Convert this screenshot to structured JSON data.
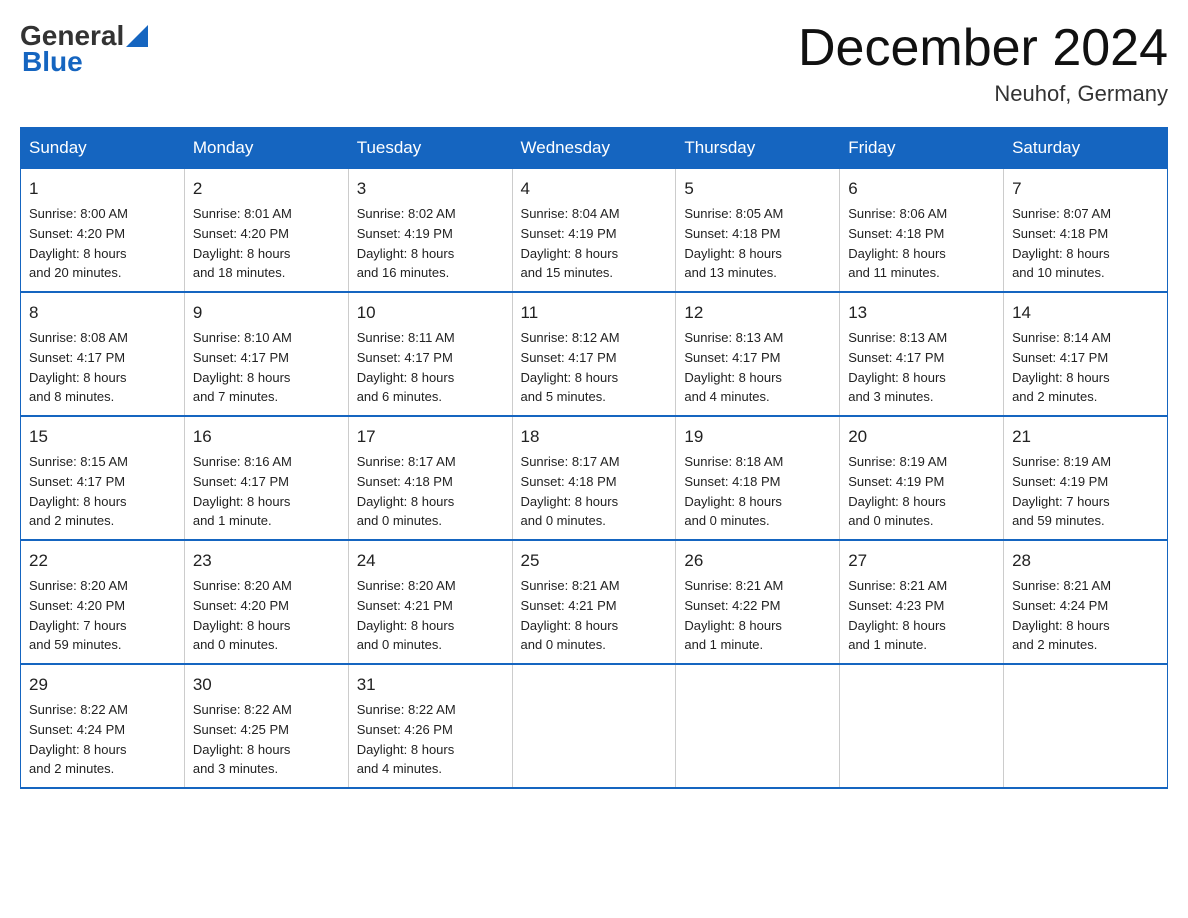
{
  "header": {
    "logo_general": "General",
    "logo_blue": "Blue",
    "month_title": "December 2024",
    "location": "Neuhof, Germany"
  },
  "days_of_week": [
    "Sunday",
    "Monday",
    "Tuesday",
    "Wednesday",
    "Thursday",
    "Friday",
    "Saturday"
  ],
  "weeks": [
    [
      {
        "day": "1",
        "info": "Sunrise: 8:00 AM\nSunset: 4:20 PM\nDaylight: 8 hours\nand 20 minutes."
      },
      {
        "day": "2",
        "info": "Sunrise: 8:01 AM\nSunset: 4:20 PM\nDaylight: 8 hours\nand 18 minutes."
      },
      {
        "day": "3",
        "info": "Sunrise: 8:02 AM\nSunset: 4:19 PM\nDaylight: 8 hours\nand 16 minutes."
      },
      {
        "day": "4",
        "info": "Sunrise: 8:04 AM\nSunset: 4:19 PM\nDaylight: 8 hours\nand 15 minutes."
      },
      {
        "day": "5",
        "info": "Sunrise: 8:05 AM\nSunset: 4:18 PM\nDaylight: 8 hours\nand 13 minutes."
      },
      {
        "day": "6",
        "info": "Sunrise: 8:06 AM\nSunset: 4:18 PM\nDaylight: 8 hours\nand 11 minutes."
      },
      {
        "day": "7",
        "info": "Sunrise: 8:07 AM\nSunset: 4:18 PM\nDaylight: 8 hours\nand 10 minutes."
      }
    ],
    [
      {
        "day": "8",
        "info": "Sunrise: 8:08 AM\nSunset: 4:17 PM\nDaylight: 8 hours\nand 8 minutes."
      },
      {
        "day": "9",
        "info": "Sunrise: 8:10 AM\nSunset: 4:17 PM\nDaylight: 8 hours\nand 7 minutes."
      },
      {
        "day": "10",
        "info": "Sunrise: 8:11 AM\nSunset: 4:17 PM\nDaylight: 8 hours\nand 6 minutes."
      },
      {
        "day": "11",
        "info": "Sunrise: 8:12 AM\nSunset: 4:17 PM\nDaylight: 8 hours\nand 5 minutes."
      },
      {
        "day": "12",
        "info": "Sunrise: 8:13 AM\nSunset: 4:17 PM\nDaylight: 8 hours\nand 4 minutes."
      },
      {
        "day": "13",
        "info": "Sunrise: 8:13 AM\nSunset: 4:17 PM\nDaylight: 8 hours\nand 3 minutes."
      },
      {
        "day": "14",
        "info": "Sunrise: 8:14 AM\nSunset: 4:17 PM\nDaylight: 8 hours\nand 2 minutes."
      }
    ],
    [
      {
        "day": "15",
        "info": "Sunrise: 8:15 AM\nSunset: 4:17 PM\nDaylight: 8 hours\nand 2 minutes."
      },
      {
        "day": "16",
        "info": "Sunrise: 8:16 AM\nSunset: 4:17 PM\nDaylight: 8 hours\nand 1 minute."
      },
      {
        "day": "17",
        "info": "Sunrise: 8:17 AM\nSunset: 4:18 PM\nDaylight: 8 hours\nand 0 minutes."
      },
      {
        "day": "18",
        "info": "Sunrise: 8:17 AM\nSunset: 4:18 PM\nDaylight: 8 hours\nand 0 minutes."
      },
      {
        "day": "19",
        "info": "Sunrise: 8:18 AM\nSunset: 4:18 PM\nDaylight: 8 hours\nand 0 minutes."
      },
      {
        "day": "20",
        "info": "Sunrise: 8:19 AM\nSunset: 4:19 PM\nDaylight: 8 hours\nand 0 minutes."
      },
      {
        "day": "21",
        "info": "Sunrise: 8:19 AM\nSunset: 4:19 PM\nDaylight: 7 hours\nand 59 minutes."
      }
    ],
    [
      {
        "day": "22",
        "info": "Sunrise: 8:20 AM\nSunset: 4:20 PM\nDaylight: 7 hours\nand 59 minutes."
      },
      {
        "day": "23",
        "info": "Sunrise: 8:20 AM\nSunset: 4:20 PM\nDaylight: 8 hours\nand 0 minutes."
      },
      {
        "day": "24",
        "info": "Sunrise: 8:20 AM\nSunset: 4:21 PM\nDaylight: 8 hours\nand 0 minutes."
      },
      {
        "day": "25",
        "info": "Sunrise: 8:21 AM\nSunset: 4:21 PM\nDaylight: 8 hours\nand 0 minutes."
      },
      {
        "day": "26",
        "info": "Sunrise: 8:21 AM\nSunset: 4:22 PM\nDaylight: 8 hours\nand 1 minute."
      },
      {
        "day": "27",
        "info": "Sunrise: 8:21 AM\nSunset: 4:23 PM\nDaylight: 8 hours\nand 1 minute."
      },
      {
        "day": "28",
        "info": "Sunrise: 8:21 AM\nSunset: 4:24 PM\nDaylight: 8 hours\nand 2 minutes."
      }
    ],
    [
      {
        "day": "29",
        "info": "Sunrise: 8:22 AM\nSunset: 4:24 PM\nDaylight: 8 hours\nand 2 minutes."
      },
      {
        "day": "30",
        "info": "Sunrise: 8:22 AM\nSunset: 4:25 PM\nDaylight: 8 hours\nand 3 minutes."
      },
      {
        "day": "31",
        "info": "Sunrise: 8:22 AM\nSunset: 4:26 PM\nDaylight: 8 hours\nand 4 minutes."
      },
      {
        "day": "",
        "info": ""
      },
      {
        "day": "",
        "info": ""
      },
      {
        "day": "",
        "info": ""
      },
      {
        "day": "",
        "info": ""
      }
    ]
  ]
}
